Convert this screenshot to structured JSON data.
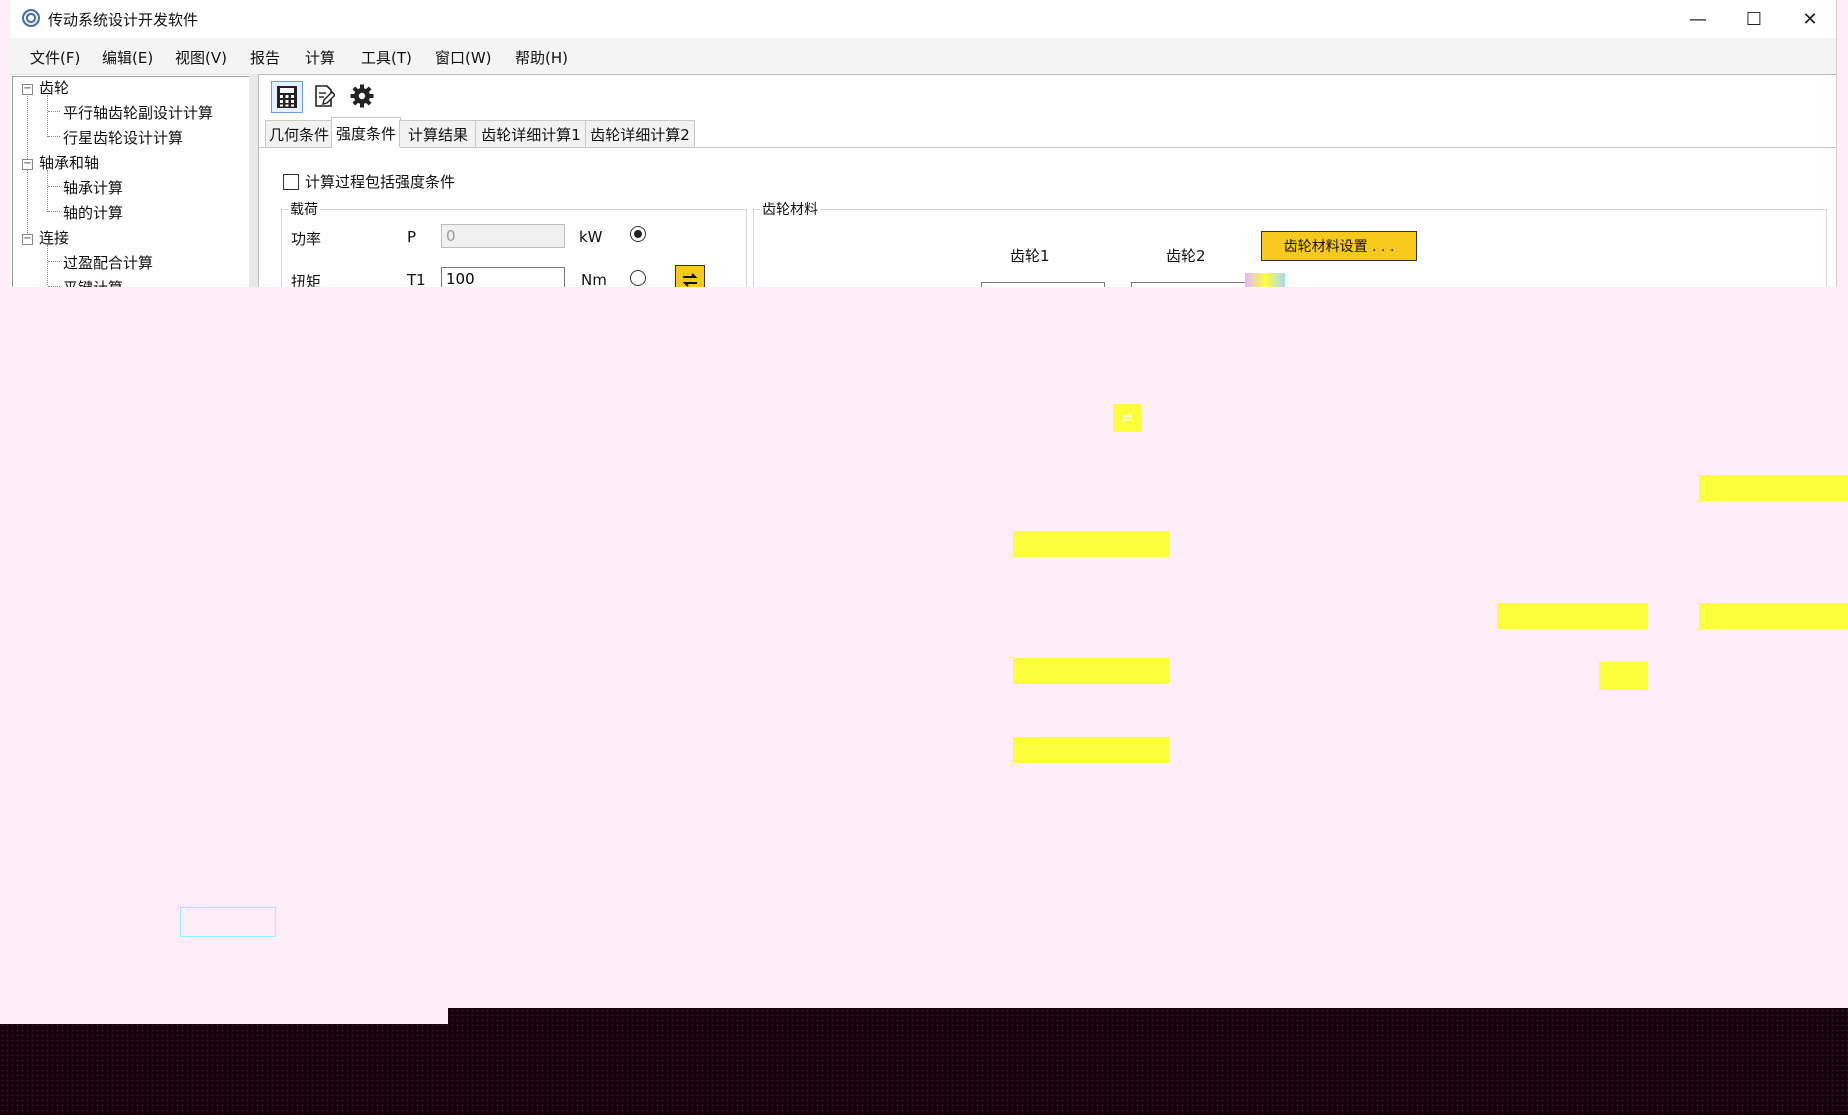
{
  "window": {
    "title": "传动系统设计开发软件",
    "controls": [
      "—",
      "☐",
      "✕"
    ]
  },
  "menu": [
    "文件(F)",
    "编辑(E)",
    "视图(V)",
    "报告",
    "计算",
    "工具(T)",
    "窗口(W)",
    "帮助(H)"
  ],
  "tree": {
    "groups": [
      {
        "label": "齿轮",
        "children": [
          "平行轴齿轮副设计计算",
          "行星齿轮设计计算"
        ]
      },
      {
        "label": "轴承和轴",
        "children": [
          "轴承计算",
          "轴的计算"
        ]
      },
      {
        "label": "连接",
        "children": [
          "过盈配合计算",
          "平键计算"
        ]
      }
    ]
  },
  "toolbar": {
    "icons": [
      "calculator-icon",
      "edit-document-icon",
      "gear-icon"
    ]
  },
  "tabs": [
    "几何条件",
    "强度条件",
    "计算结果",
    "齿轮详细计算1",
    "齿轮详细计算2"
  ],
  "active_tab": 1,
  "strength": {
    "include_checkbox": "计算过程包括强度条件",
    "load_group": "载荷",
    "power": {
      "label": "功率",
      "symbol": "P",
      "value": "0",
      "unit": "kW"
    },
    "torque": {
      "label": "扭矩",
      "symbol": "T1",
      "value": "100",
      "unit": "Nm"
    },
    "material_group": "齿轮材料",
    "gear1": "齿轮1",
    "gear2": "齿轮2",
    "material_button": "齿轮材料设置 . . ."
  },
  "colors": {
    "accent_yellow": "#f7c91a",
    "overlay_pink": "#fdeefa"
  }
}
